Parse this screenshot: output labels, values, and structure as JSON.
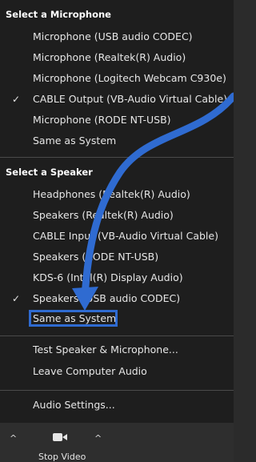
{
  "microphone": {
    "header": "Select a Microphone",
    "items": [
      {
        "label": "Microphone (USB audio CODEC)",
        "checked": false
      },
      {
        "label": "Microphone (Realtek(R) Audio)",
        "checked": false
      },
      {
        "label": "Microphone (Logitech Webcam C930e)",
        "checked": false
      },
      {
        "label": "CABLE Output (VB-Audio Virtual Cable)",
        "checked": true
      },
      {
        "label": "Microphone (RODE NT-USB)",
        "checked": false
      },
      {
        "label": "Same as System",
        "checked": false
      }
    ]
  },
  "speaker": {
    "header": "Select a Speaker",
    "items": [
      {
        "label": "Headphones (Realtek(R) Audio)",
        "checked": false
      },
      {
        "label": "Speakers (Realtek(R) Audio)",
        "checked": false
      },
      {
        "label": "CABLE Input (VB-Audio Virtual Cable)",
        "checked": false
      },
      {
        "label": "Speakers (RODE NT-USB)",
        "checked": false
      },
      {
        "label": "KDS-6 (Intel(R) Display Audio)",
        "checked": false
      },
      {
        "label": "Speakers (USB audio CODEC)",
        "checked": true
      },
      {
        "label": "Same as System",
        "checked": false
      }
    ]
  },
  "actions": {
    "test": "Test Speaker & Microphone...",
    "leave": "Leave Computer Audio",
    "settings": "Audio Settings..."
  },
  "toolbar": {
    "stop_video": "Stop Video",
    "caret": "^"
  },
  "check_glyph": "✓",
  "colors": {
    "menu_bg": "#1e1e1e",
    "highlight_border": "#2f6bd1",
    "arrow": "#2f6bd1"
  }
}
